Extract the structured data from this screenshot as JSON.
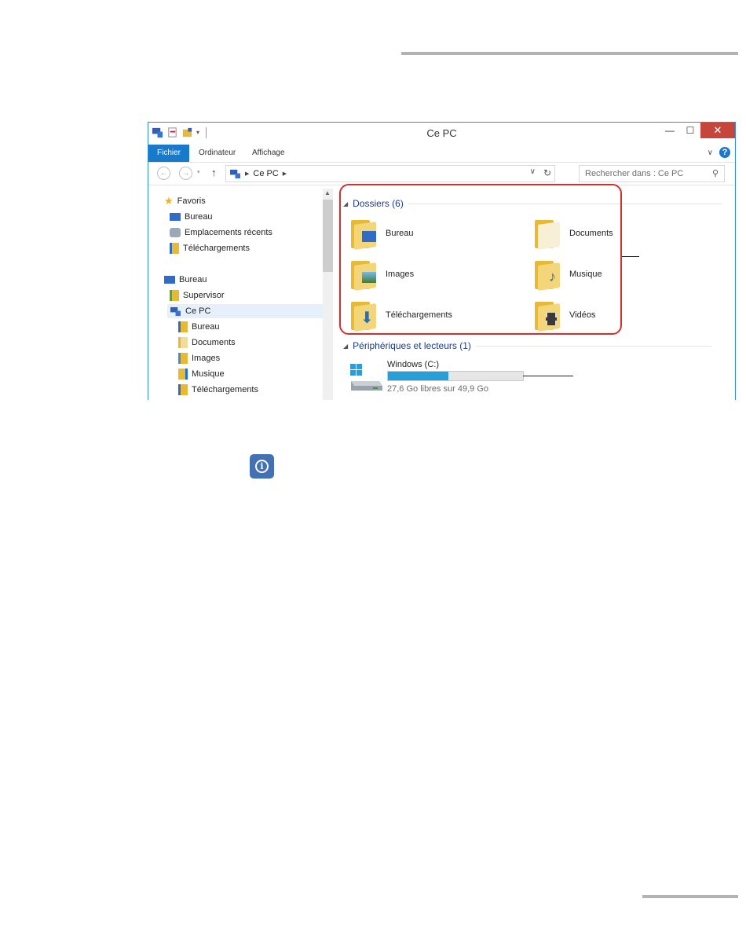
{
  "window": {
    "title": "Ce PC",
    "controls": {
      "minimize": "—",
      "maximize": "☐",
      "close": "✕"
    }
  },
  "ribbon": {
    "tabs": [
      "Fichier",
      "Ordinateur",
      "Affichage"
    ],
    "help": "?"
  },
  "address": {
    "location": "Ce PC",
    "search_placeholder": "Rechercher dans : Ce PC"
  },
  "nav": {
    "items": [
      {
        "label": "Favoris",
        "icon": "star-icon"
      },
      {
        "label": "Bureau",
        "icon": "desktop-icon"
      },
      {
        "label": "Emplacements récents",
        "icon": "recent-places-icon"
      },
      {
        "label": "Téléchargements",
        "icon": "downloads-folder-icon"
      },
      {
        "label": "Bureau",
        "icon": "desktop-icon"
      },
      {
        "label": "Supervisor",
        "icon": "user-folder-icon"
      },
      {
        "label": "Ce PC",
        "icon": "computer-icon"
      },
      {
        "label": "Bureau",
        "icon": "desktop-folder-icon"
      },
      {
        "label": "Documents",
        "icon": "documents-folder-icon"
      },
      {
        "label": "Images",
        "icon": "pictures-folder-icon"
      },
      {
        "label": "Musique",
        "icon": "music-folder-icon"
      },
      {
        "label": "Téléchargements",
        "icon": "downloads-folder-icon"
      }
    ]
  },
  "content": {
    "folders_header": "Dossiers (6)",
    "folders": [
      {
        "label": "Bureau",
        "icon": "desktop-folder-icon"
      },
      {
        "label": "Documents",
        "icon": "documents-folder-icon"
      },
      {
        "label": "Images",
        "icon": "pictures-folder-icon"
      },
      {
        "label": "Musique",
        "icon": "music-folder-icon"
      },
      {
        "label": "Téléchargements",
        "icon": "downloads-folder-icon"
      },
      {
        "label": "Vidéos",
        "icon": "videos-folder-icon"
      }
    ],
    "devices_header": "Périphériques et lecteurs (1)",
    "drive": {
      "name": "Windows (C:)",
      "usage_text": "27,6 Go libres sur 49,9 Go",
      "used_fraction": 0.45
    }
  },
  "colors": {
    "accent": "#1979ca",
    "callout": "#d32f2f",
    "drive_bar": "#26a0da",
    "info_badge": "#4471b3"
  }
}
